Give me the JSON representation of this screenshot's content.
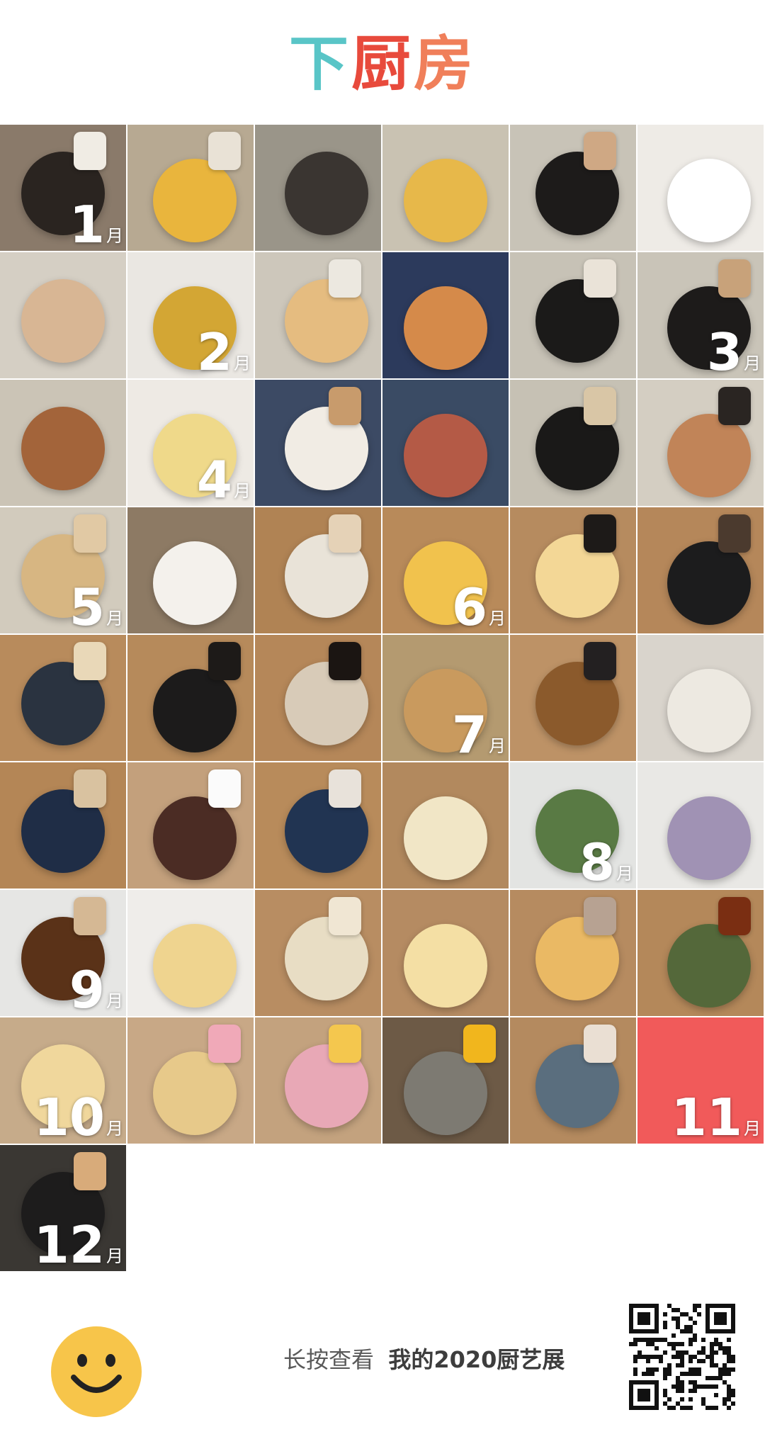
{
  "logo": {
    "chars": [
      "下",
      "厨",
      "房"
    ],
    "colors": [
      "#59c5c7",
      "#e84a3c",
      "#f07f5a"
    ]
  },
  "grid": {
    "cells": [
      {
        "bg": "#8a7a6a",
        "plate": "#2a2420",
        "cup": "#f0ece4",
        "month": "1"
      },
      {
        "bg": "#b7a992",
        "plate": "#e9b53d",
        "cup": "#e9e2d6",
        "month": ""
      },
      {
        "bg": "#9a9589",
        "plate": "#3a3531",
        "cup": "",
        "month": ""
      },
      {
        "bg": "#c9c2b2",
        "plate": "#e7b84a",
        "cup": "",
        "month": ""
      },
      {
        "bg": "#c8c3b7",
        "plate": "#1d1b1a",
        "cup": "#cfa884",
        "month": ""
      },
      {
        "bg": "#eeebe6",
        "plate": "#ffffff",
        "cup": "",
        "month": ""
      },
      {
        "bg": "#d5cfc4",
        "plate": "#d8b694",
        "cup": "",
        "month": ""
      },
      {
        "bg": "#eae7e2",
        "plate": "#d3a634",
        "cup": "",
        "month": "2"
      },
      {
        "bg": "#cdc7bb",
        "plate": "#e5bc80",
        "cup": "#ece8e0",
        "month": ""
      },
      {
        "bg": "#2c3a5c",
        "plate": "#d58a4a",
        "cup": "",
        "month": ""
      },
      {
        "bg": "#c7c2b6",
        "plate": "#1b1a19",
        "cup": "#eae3d8",
        "month": ""
      },
      {
        "bg": "#c9c4b8",
        "plate": "#1d1b1a",
        "cup": "#c8a27a",
        "month": "3"
      },
      {
        "bg": "#cbc4b6",
        "plate": "#a3643a",
        "cup": "",
        "month": ""
      },
      {
        "bg": "#eeeae4",
        "plate": "#efd98a",
        "cup": "",
        "month": "4"
      },
      {
        "bg": "#3c4a64",
        "plate": "#f1ece4",
        "cup": "#c89b6c",
        "month": ""
      },
      {
        "bg": "#3a4b64",
        "plate": "#b45a46",
        "cup": "",
        "month": ""
      },
      {
        "bg": "#c6c1b4",
        "plate": "#1a1918",
        "cup": "#d9c6a6",
        "month": ""
      },
      {
        "bg": "#d4cec2",
        "plate": "#c18458",
        "cup": "#2a2522",
        "month": ""
      },
      {
        "bg": "#d2cbbd",
        "plate": "#d7b682",
        "cup": "#e1c9a4",
        "month": "5"
      },
      {
        "bg": "#8d7a64",
        "plate": "#f4f1ec",
        "cup": "",
        "month": ""
      },
      {
        "bg": "#b08354",
        "plate": "#e9e3d8",
        "cup": "#e5d2b7",
        "month": ""
      },
      {
        "bg": "#b88a5a",
        "plate": "#f1c24d",
        "cup": "",
        "month": "6"
      },
      {
        "bg": "#b68b5f",
        "plate": "#f3d796",
        "cup": "#1d1a18",
        "month": ""
      },
      {
        "bg": "#b5875a",
        "plate": "#1c1c1d",
        "cup": "#4b3a2e",
        "month": ""
      },
      {
        "bg": "#b88b5c",
        "plate": "#2a3340",
        "cup": "#e9d8b8",
        "month": ""
      },
      {
        "bg": "#b68a5b",
        "plate": "#1c1b1b",
        "cup": "#1d1a18",
        "month": ""
      },
      {
        "bg": "#b58759",
        "plate": "#d8cbb8",
        "cup": "#1b1512",
        "month": ""
      },
      {
        "bg": "#b49a70",
        "plate": "#c99a5e",
        "cup": "",
        "month": "7"
      },
      {
        "bg": "#bd9266",
        "plate": "#8b5a2c",
        "cup": "#232021",
        "month": ""
      },
      {
        "bg": "#d9d4cc",
        "plate": "#ede9e1",
        "cup": "",
        "month": ""
      },
      {
        "bg": "#b48656",
        "plate": "#1f2d46",
        "cup": "#d9c2a0",
        "month": ""
      },
      {
        "bg": "#c3a07c",
        "plate": "#4b2c24",
        "cup": "#fbfbfb",
        "month": ""
      },
      {
        "bg": "#b88b5b",
        "plate": "#213452",
        "cup": "#e8e2da",
        "month": ""
      },
      {
        "bg": "#b2895e",
        "plate": "#f1e6c6",
        "cup": "",
        "month": ""
      },
      {
        "bg": "#e3e4e2",
        "plate": "#597a44",
        "cup": "",
        "month": "8"
      },
      {
        "bg": "#e9e8e5",
        "plate": "#a092b4",
        "cup": "",
        "month": ""
      },
      {
        "bg": "#e6e6e4",
        "plate": "#5a3218",
        "cup": "#d5b894",
        "month": "9"
      },
      {
        "bg": "#efedea",
        "plate": "#efd48f",
        "cup": "",
        "month": ""
      },
      {
        "bg": "#b88d62",
        "plate": "#e8ddc4",
        "cup": "#f0e6d3",
        "month": ""
      },
      {
        "bg": "#b58b62",
        "plate": "#f4dfa4",
        "cup": "",
        "month": ""
      },
      {
        "bg": "#b68b60",
        "plate": "#eab964",
        "cup": "#b7a292",
        "month": ""
      },
      {
        "bg": "#b4885a",
        "plate": "#54683a",
        "cup": "#7a2e12",
        "month": ""
      },
      {
        "bg": "#c6ab8a",
        "plate": "#f0d79c",
        "cup": "",
        "month": "10"
      },
      {
        "bg": "#c8a886",
        "plate": "#e7c98a",
        "cup": "#f0a9b8",
        "month": ""
      },
      {
        "bg": "#c3a27e",
        "plate": "#e8a8b6",
        "cup": "#f4c74e",
        "month": ""
      },
      {
        "bg": "#6d5a46",
        "plate": "#7d7a72",
        "cup": "#f1b61d",
        "month": ""
      },
      {
        "bg": "#b48a5f",
        "plate": "#5a6e7e",
        "cup": "#eadfd3",
        "month": ""
      },
      {
        "bg": "#f15a5a",
        "plate": "",
        "cup": "",
        "month": "11",
        "red": true
      },
      {
        "bg": "#3a3733",
        "plate": "#1d1c1c",
        "cup": "#d8ab7a",
        "month": "12"
      }
    ],
    "month_suffix": "月"
  },
  "footer": {
    "text_prefix": "长按查看",
    "text_emphasis": "我的2020厨艺展"
  }
}
